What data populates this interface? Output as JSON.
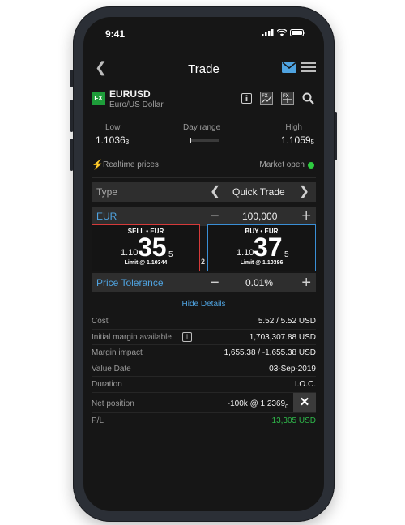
{
  "status": {
    "time": "9:41"
  },
  "nav": {
    "title": "Trade"
  },
  "instrument": {
    "badge": "FX",
    "symbol": "EURUSD",
    "description": "Euro/US Dollar"
  },
  "ranges": {
    "low_label": "Low",
    "low_value": "1.1036",
    "low_pip": "3",
    "day_range_label": "Day range",
    "day_range_position": 0.0,
    "high_label": "High",
    "high_value": "1.1059",
    "high_pip": "5"
  },
  "prices_status": {
    "realtime": "Realtime prices",
    "market": "Market open"
  },
  "order": {
    "type_label": "Type",
    "type_value": "Quick Trade",
    "currency_label": "EUR",
    "amount": "100,000",
    "tolerance_label": "Price Tolerance",
    "tolerance_value": "0.01%"
  },
  "sell": {
    "header": "SELL • EUR",
    "prefix": "1.10",
    "big": "35",
    "pip": "5",
    "limit": "Limit @ 1.10344"
  },
  "buy": {
    "header": "BUY • EUR",
    "prefix": "1.10",
    "big": "37",
    "pip": "5",
    "limit": "Limit @ 1.10386"
  },
  "spread": "2",
  "hide_details": "Hide Details",
  "details": [
    {
      "key": "Cost",
      "value": "5.52 / 5.52 USD"
    },
    {
      "key": "Initial margin available",
      "value": "1,703,307.88 USD"
    },
    {
      "key": "Margin impact",
      "value": "1,655.38 / -1,655.38 USD"
    },
    {
      "key": "Value Date",
      "value": "03-Sep-2019"
    },
    {
      "key": "Duration",
      "value": "I.O.C."
    },
    {
      "key": "Net position",
      "value": "-100k @ 1.2369",
      "value_pip": "0"
    },
    {
      "key": "P/L",
      "value": "13,305 USD"
    }
  ],
  "colors": {
    "sell": "#d63a3a",
    "buy": "#3a8fd6",
    "positive": "#2fb84a",
    "link": "#4fa3e0",
    "fx_badge": "#1e9d3a"
  }
}
